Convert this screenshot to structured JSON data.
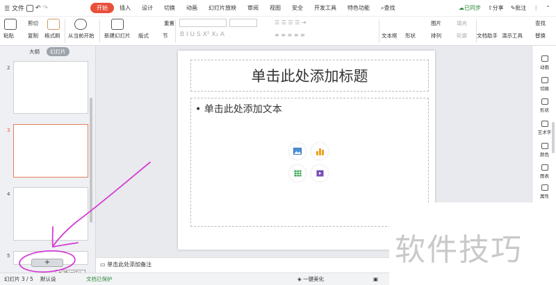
{
  "tabbar": {
    "menu_label": "文件",
    "tabs": [
      "开始",
      "插入",
      "设计",
      "切换",
      "动画",
      "幻灯片放映",
      "审阅",
      "视图",
      "安全",
      "开发工具",
      "特色功能"
    ],
    "search_label": "查找",
    "sync_label": "已同步",
    "share_label": "分享",
    "comment_label": "批注"
  },
  "ribbon": {
    "paste": "粘贴",
    "cut": "剪切",
    "copy": "复制",
    "format_painter": "格式刷",
    "from_current": "从当前开始",
    "new_slide": "新建幻灯片",
    "layout": "版式",
    "section": "节",
    "reset": "重置",
    "textbox": "文本框",
    "shape": "形状",
    "arrange": "排列",
    "picture": "图片",
    "fill": "填充",
    "outline": "轮廓",
    "doc_assistant": "文档助手",
    "presenter_tool": "演示工具",
    "find": "查找",
    "replace": "替换"
  },
  "left_panel": {
    "tabs": [
      "大纲",
      "幻灯片"
    ],
    "thumb_numbers": [
      "2",
      "3",
      "4",
      "5"
    ],
    "new_slide_button": "+",
    "tooltip": "新建幻灯片"
  },
  "slide": {
    "title_placeholder": "单击此处添加标题",
    "body_placeholder": "• 单击此处添加文本"
  },
  "notes": {
    "placeholder": "单击此处添加备注"
  },
  "right_sidebar": {
    "items": [
      "动画",
      "切换",
      "形状",
      "艺术字",
      "颜色",
      "图表",
      "属性"
    ]
  },
  "statusbar": {
    "slide_count": "幻灯片 3 / 5",
    "theme": "默认设",
    "protected": "文档已保护",
    "beautify": "一键美化"
  },
  "watermark": {
    "text": "软件技巧"
  },
  "colors": {
    "accent": "#e8503a",
    "selected_thumb_border": "#e87b5a",
    "annotation": "#d63bd6"
  }
}
